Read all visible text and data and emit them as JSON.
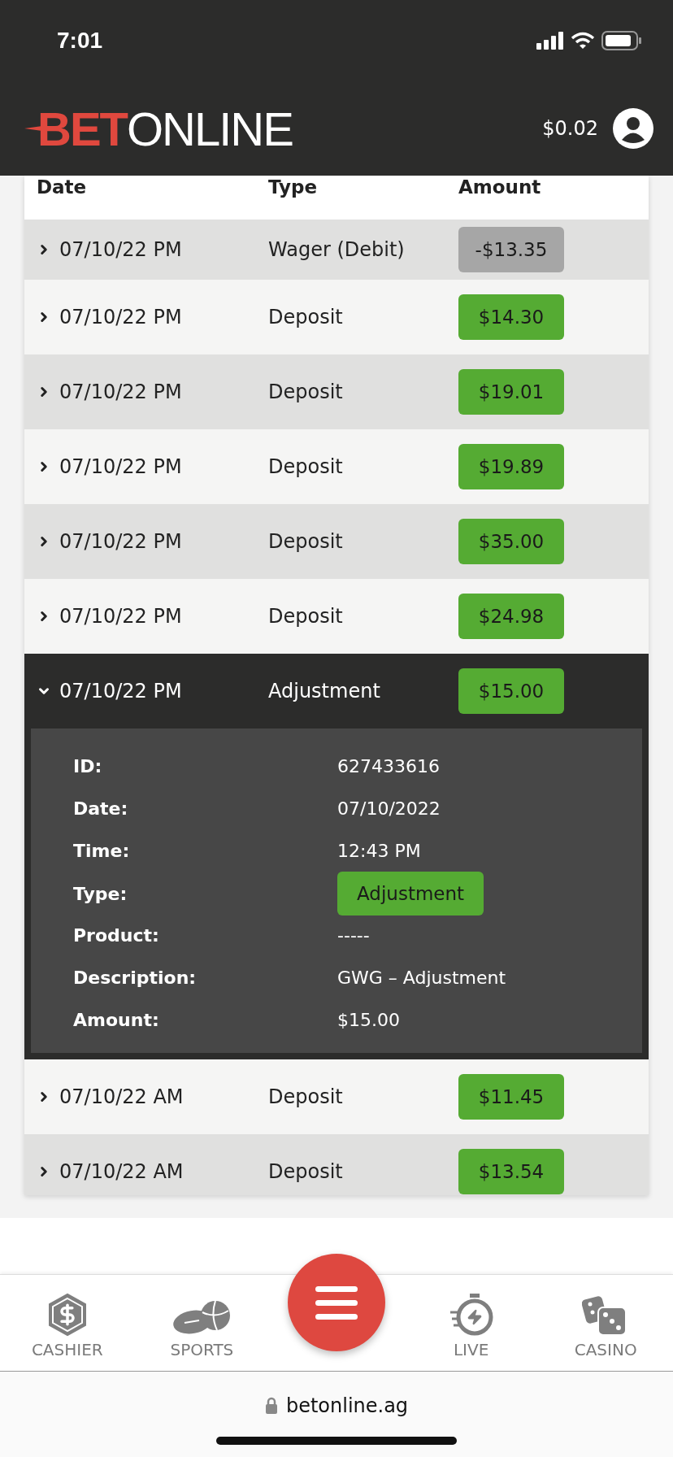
{
  "status_bar": {
    "time": "7:01"
  },
  "header": {
    "logo": {
      "part_1": "BET",
      "part_2": "ONLINE"
    },
    "balance": "$0.02"
  },
  "table": {
    "columns": [
      "Date",
      "Type",
      "Amount"
    ],
    "rows": [
      {
        "date": "07/10/22 PM",
        "type": "Wager (Debit)",
        "amount": "-$13.35",
        "kind": "debit",
        "expanded": false
      },
      {
        "date": "07/10/22 PM",
        "type": "Deposit",
        "amount": "$14.30",
        "kind": "credit",
        "expanded": false
      },
      {
        "date": "07/10/22 PM",
        "type": "Deposit",
        "amount": "$19.01",
        "kind": "credit",
        "expanded": false
      },
      {
        "date": "07/10/22 PM",
        "type": "Deposit",
        "amount": "$19.89",
        "kind": "credit",
        "expanded": false
      },
      {
        "date": "07/10/22 PM",
        "type": "Deposit",
        "amount": "$35.00",
        "kind": "credit",
        "expanded": false
      },
      {
        "date": "07/10/22 PM",
        "type": "Deposit",
        "amount": "$24.98",
        "kind": "credit",
        "expanded": false
      },
      {
        "date": "07/10/22 PM",
        "type": "Adjustment",
        "amount": "$15.00",
        "kind": "credit",
        "expanded": true,
        "details": [
          {
            "label": "ID:",
            "value": "627433616",
            "kind": "text"
          },
          {
            "label": "Date:",
            "value": "07/10/2022",
            "kind": "text"
          },
          {
            "label": "Time:",
            "value": "12:43 PM",
            "kind": "text"
          },
          {
            "label": "Type:",
            "value": "Adjustment",
            "kind": "badge"
          },
          {
            "label": "Product:",
            "value": "-----",
            "kind": "text"
          },
          {
            "label": "Description:",
            "value": "GWG – Adjustment",
            "kind": "text"
          },
          {
            "label": "Amount:",
            "value": "$15.00",
            "kind": "text"
          }
        ]
      },
      {
        "date": "07/10/22 AM",
        "type": "Deposit",
        "amount": "$11.45",
        "kind": "credit",
        "expanded": false
      },
      {
        "date": "07/10/22 AM",
        "type": "Deposit",
        "amount": "$13.54",
        "kind": "credit",
        "expanded": false
      }
    ]
  },
  "bottom_nav": [
    {
      "kind": "tab",
      "label": "CASHIER"
    },
    {
      "kind": "tab",
      "label": "SPORTS"
    },
    {
      "kind": "menu"
    },
    {
      "kind": "tab",
      "label": "LIVE"
    },
    {
      "kind": "tab",
      "label": "CASINO"
    }
  ],
  "browser": {
    "url": "betonline.ag"
  }
}
